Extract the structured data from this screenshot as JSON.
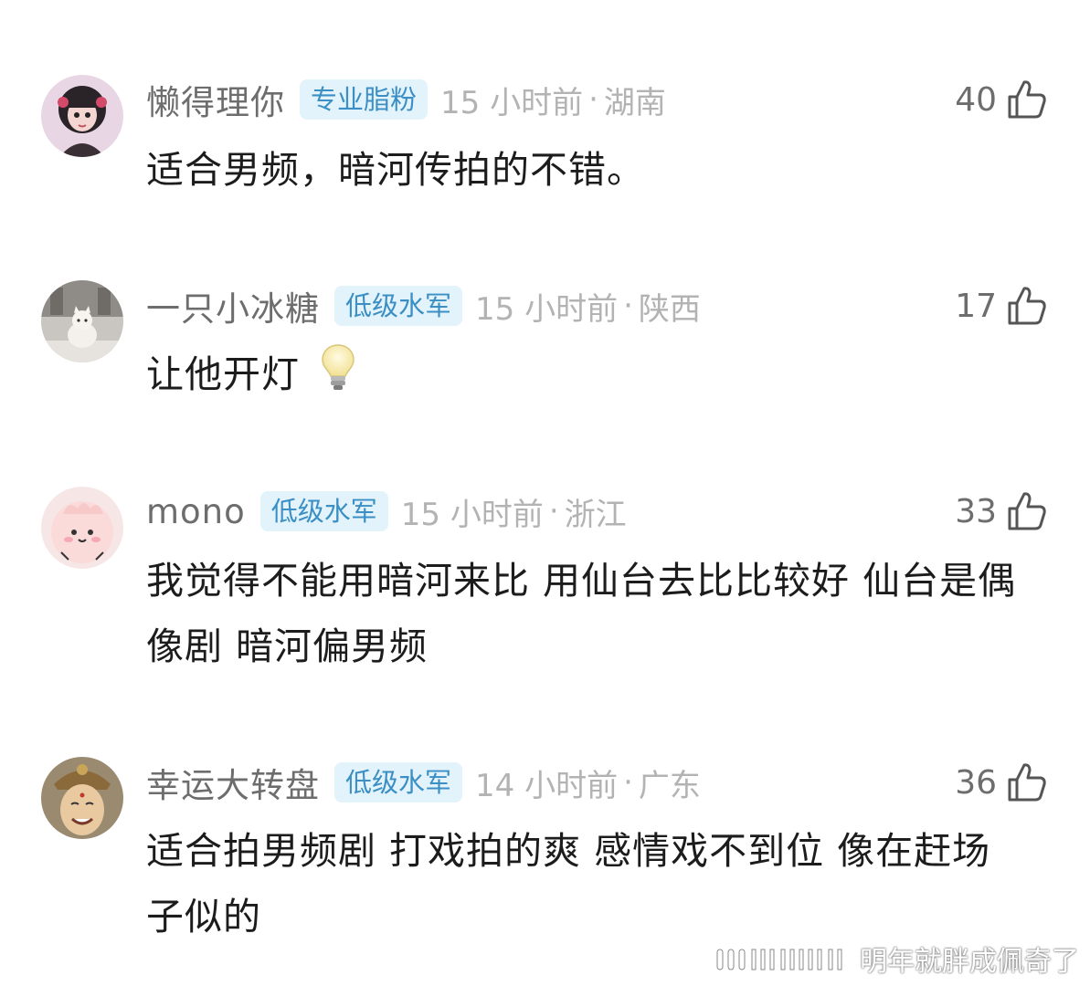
{
  "comments": [
    {
      "username": "懒得理你",
      "badge": "专业脂粉",
      "time": "15 小时前",
      "separator": "·",
      "region": "湖南",
      "likes": "40",
      "text": "适合男频，暗河传拍的不错。"
    },
    {
      "username": "一只小冰糖",
      "badge": "低级水军",
      "time": "15 小时前",
      "separator": "·",
      "region": "陕西",
      "likes": "17",
      "text": "让他开灯"
    },
    {
      "username": "mono",
      "badge": "低级水军",
      "time": "15 小时前",
      "separator": "·",
      "region": "浙江",
      "likes": "33",
      "text": "我觉得不能用暗河来比 用仙台去比比较好 仙台是偶像剧 暗河偏男频"
    },
    {
      "username": "幸运大转盘",
      "badge": "低级水军",
      "time": "14 小时前",
      "separator": "·",
      "region": "广东",
      "likes": "36",
      "text": "适合拍男频剧 打戏拍的爽 感情戏不到位 像在赶场子似的"
    }
  ],
  "watermark": "明年就胖成佩奇了",
  "colors": {
    "badge_bg": "#e3f3fb",
    "badge_text": "#3b8fc4",
    "meta_gray": "#b3b3b3",
    "username_gray": "#6d6d6d"
  },
  "icons": {
    "like": "thumbs-up-icon",
    "bulb": "light-bulb-icon"
  }
}
